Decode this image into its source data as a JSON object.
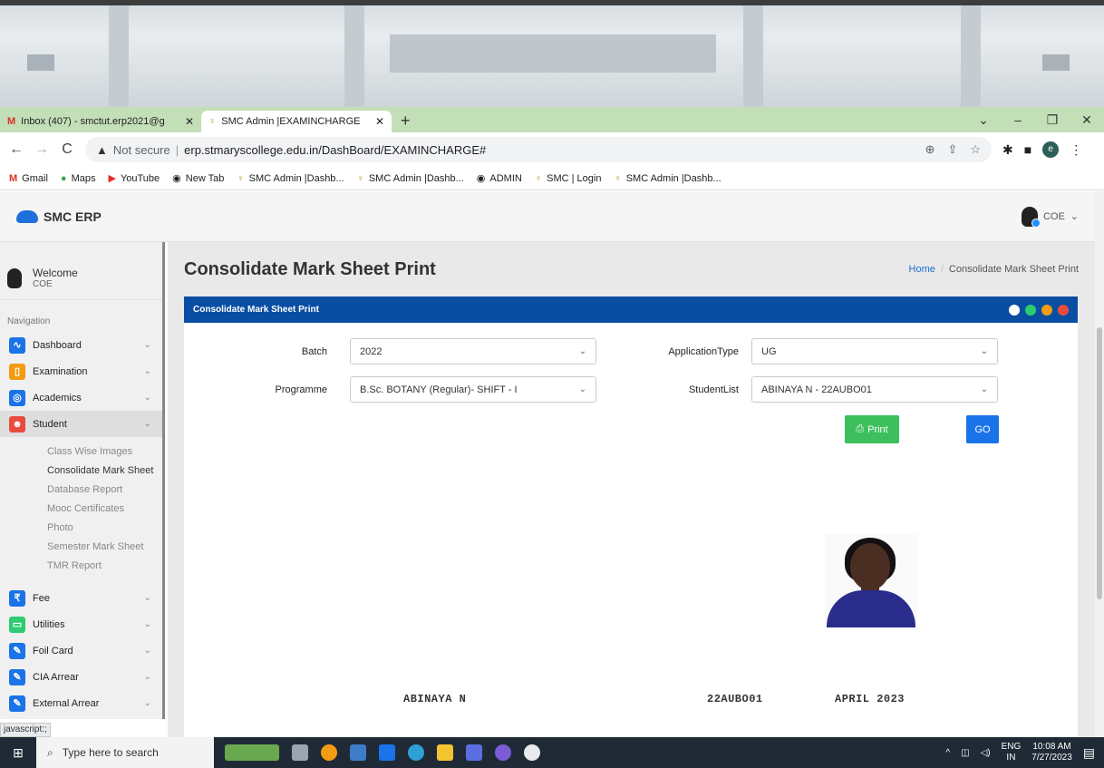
{
  "browser": {
    "tabs": [
      {
        "label": "Inbox (407) - smctut.erp2021@g",
        "icon": "gmail-icon"
      },
      {
        "label": "SMC Admin |EXAMINCHARGE",
        "icon": "smc-icon"
      }
    ],
    "new_tab": "+",
    "address": {
      "security": "Not secure",
      "url": "erp.stmaryscollege.edu.in/DashBoard/EXAMINCHARGE#"
    },
    "bookmarks": [
      "Gmail",
      "Maps",
      "YouTube",
      "New Tab",
      "SMC Admin |Dashb...",
      "SMC Admin |Dashb...",
      "ADMIN",
      "SMC | Login",
      "SMC Admin |Dashb..."
    ]
  },
  "app": {
    "brand": "SMC ERP",
    "user": "COE",
    "welcome": "Welcome",
    "welcome_user": "COE",
    "nav_label": "Navigation",
    "nav": [
      {
        "label": "Dashboard",
        "color": "#1a73e8"
      },
      {
        "label": "Examination",
        "color": "#f39c12"
      },
      {
        "label": "Academics",
        "color": "#1a73e8"
      },
      {
        "label": "Student",
        "color": "#e74c3c"
      }
    ],
    "student_sub": [
      "Class Wise Images",
      "Consolidate Mark Sheet",
      "Database Report",
      "Mooc Certificates",
      "Photo",
      "Semester Mark Sheet",
      "TMR Report"
    ],
    "nav2": [
      {
        "label": "Fee",
        "color": "#1a73e8"
      },
      {
        "label": "Utilities",
        "color": "#2ecc71"
      },
      {
        "label": "Foil Card",
        "color": "#1a73e8"
      },
      {
        "label": "CIA Arrear",
        "color": "#1a73e8"
      },
      {
        "label": "External Arrear",
        "color": "#1a73e8"
      }
    ]
  },
  "page": {
    "title": "Consolidate Mark Sheet Print",
    "breadcrumb": {
      "home": "Home",
      "current": "Consolidate Mark Sheet Print"
    },
    "panel_title": "Consolidate Mark Sheet Print",
    "form": {
      "batch_label": "Batch",
      "batch_value": "2022",
      "apptype_label": "ApplicationType",
      "apptype_value": "UG",
      "programme_label": "Programme",
      "programme_value": "B.Sc. BOTANY (Regular)- SHIFT - I",
      "studentlist_label": "StudentList",
      "studentlist_value": "ABINAYA N - 22AUBO01"
    },
    "print_label": "Print",
    "go_label": "GO",
    "student": {
      "name": "ABINAYA N",
      "regno": "22AUBO01",
      "exam": "APRIL 2023"
    }
  },
  "status_text": "javascript:;",
  "taskbar": {
    "search_placeholder": "Type here to search",
    "lang_1": "ENG",
    "lang_2": "IN",
    "time": "10:08 AM",
    "date": "7/27/2023"
  }
}
